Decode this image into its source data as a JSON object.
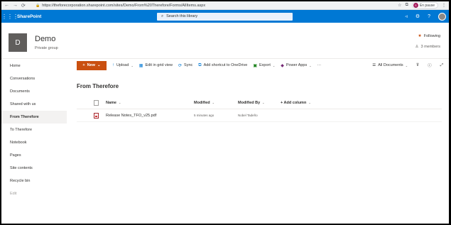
{
  "browser": {
    "url": "https://theforecorporation.sharepoint.com/sites/Demo/From%20Therefore/Forms/AllItems.aspx",
    "profile_initial": "S",
    "profile_status": "En pause"
  },
  "suitebar": {
    "brand": "SharePoint",
    "search_placeholder": "Search this library"
  },
  "site": {
    "logo_letter": "D",
    "title": "Demo",
    "subtitle": "Private group",
    "follow_label": "Following",
    "members_label": "3 members"
  },
  "nav": {
    "items": [
      {
        "label": "Home"
      },
      {
        "label": "Conversations"
      },
      {
        "label": "Documents"
      },
      {
        "label": "Shared with us"
      },
      {
        "label": "From Therefore"
      },
      {
        "label": "To Therefore"
      },
      {
        "label": "Notebook"
      },
      {
        "label": "Pages"
      },
      {
        "label": "Site contents"
      },
      {
        "label": "Recycle bin"
      },
      {
        "label": "Edit"
      }
    ]
  },
  "commands": {
    "new": "New",
    "upload": "Upload",
    "grid": "Edit in grid view",
    "sync": "Sync",
    "shortcut": "Add shortcut to OneDrive",
    "export": "Export",
    "powerapps": "Power Apps",
    "more": "···",
    "view": "All Documents"
  },
  "library": {
    "title": "From Therefore",
    "columns": {
      "name": "Name",
      "modified": "Modified",
      "modified_by": "Modified By",
      "add_column": "+ Add column"
    },
    "rows": [
      {
        "name": "Release Notes_TFO_v25.pdf",
        "modified": "5 minutes ago",
        "modified_by": "Nobel Tadeño"
      }
    ]
  },
  "colors": {
    "suitebar": "#0078d4",
    "new_button": "#ca5010"
  }
}
